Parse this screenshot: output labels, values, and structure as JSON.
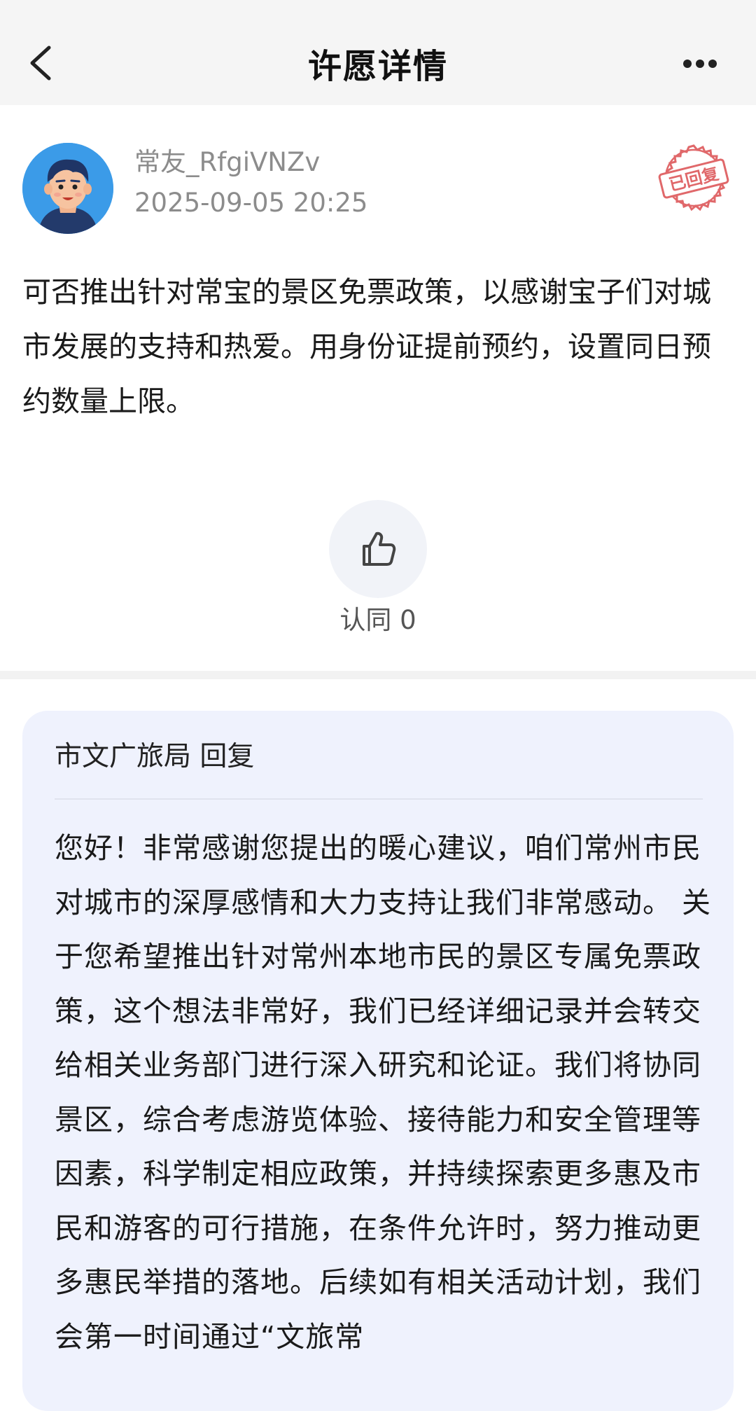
{
  "nav": {
    "title": "许愿详情",
    "back_icon": "chevron-left-icon",
    "more_icon": "more-horizontal-icon"
  },
  "post": {
    "username": "常友_RfgiVNZv",
    "timestamp": "2025-09-05 20:25",
    "status_stamp": "已回复",
    "content": "可否推出针对常宝的景区免票政策，以感谢宝子们对城市发展的支持和热爱。用身份证提前预约，设置同日预约数量上限。",
    "like_label": "认同 0",
    "like_icon": "thumbs-up-icon"
  },
  "reply": {
    "header": "市文广旅局 回复",
    "body": "您好！非常感谢您提出的暖心建议，咱们常州市民对城市的深厚感情和大力支持让我们非常感动。 关于您希望推出针对常州本地市民的景区专属免票政策，这个想法非常好，我们已经详细记录并会转交给相关业务部门进行深入研究和论证。我们将协同景区，综合考虑游览体验、接待能力和安全管理等因素，科学制定相应政策，并持续探索更多惠及市民和游客的可行措施，在条件允许时，努力推动更多惠民举措的落地。后续如有相关活动计划，我们会第一时间通过“文旅常"
  },
  "colors": {
    "nav_bg": "#f5f5f5",
    "reply_card_bg": "#eff2fd",
    "stamp_red": "#e0686a",
    "avatar_bg": "#3b9be8"
  }
}
